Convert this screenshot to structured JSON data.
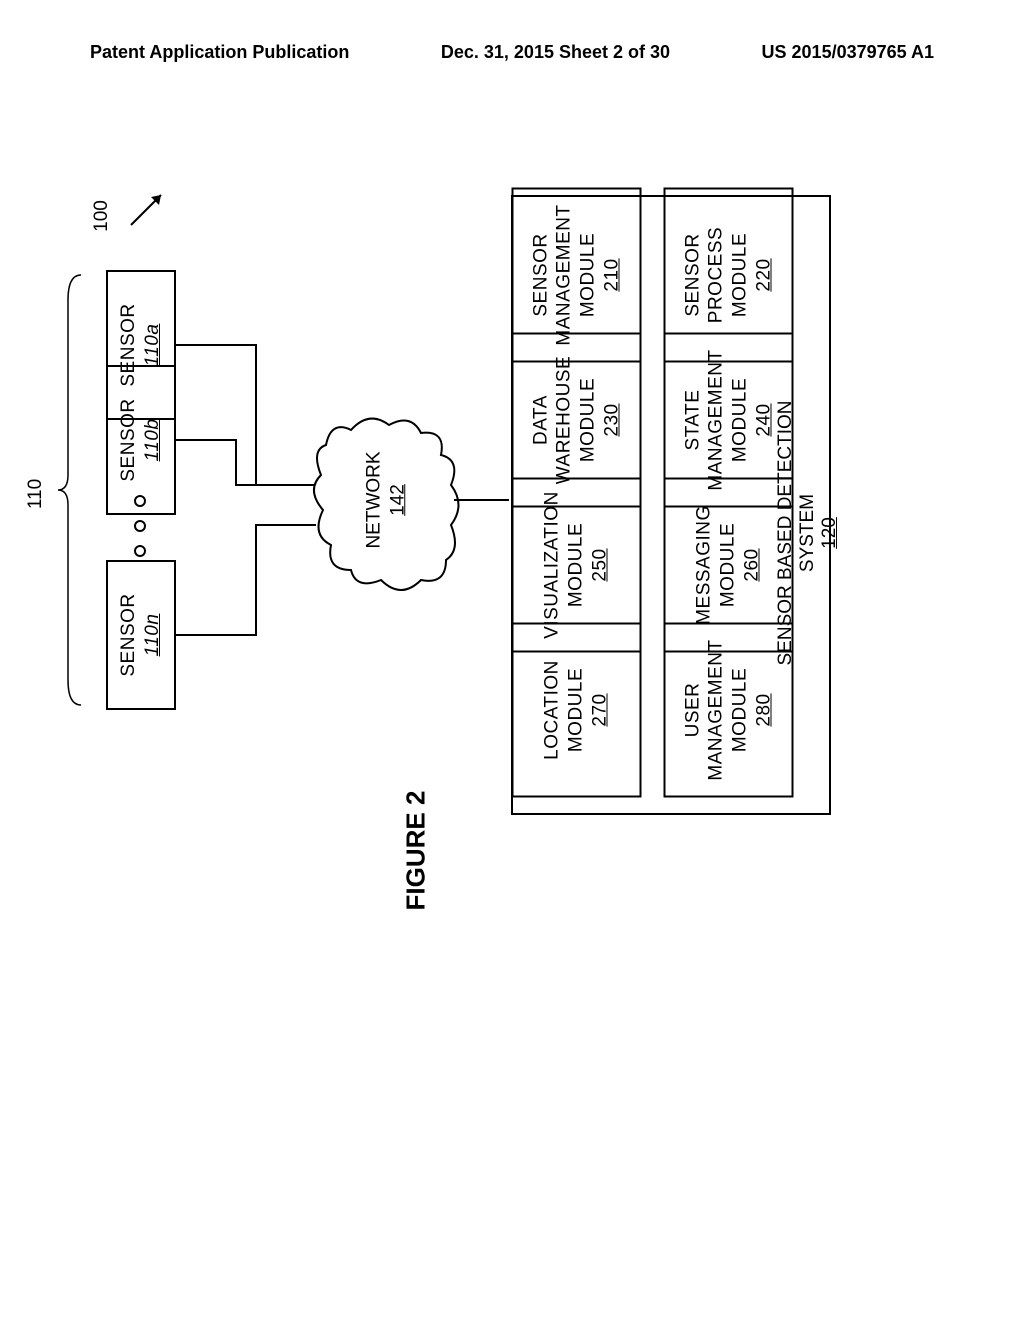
{
  "header": {
    "left": "Patent Application Publication",
    "center": "Dec. 31, 2015  Sheet 2 of 30",
    "right": "US 2015/0379765 A1"
  },
  "ref100": "100",
  "ref110": "110",
  "sensors": {
    "a": {
      "label": "SENSOR",
      "ref": "110a"
    },
    "b": {
      "label": "SENSOR",
      "ref": "110b"
    },
    "n": {
      "label": "SENSOR",
      "ref": "110n"
    }
  },
  "network": {
    "label": "NETWORK",
    "ref": "142"
  },
  "system": {
    "label": "SENSOR BASED DETECTION SYSTEM",
    "ref": "120"
  },
  "modules": {
    "m210": {
      "l1": "SENSOR",
      "l2": "MANAGEMENT",
      "l3": "MODULE",
      "ref": "210"
    },
    "m220": {
      "l1": "SENSOR",
      "l2": "PROCESS",
      "l3": "MODULE",
      "ref": "220"
    },
    "m230": {
      "l1": "DATA",
      "l2": "WAREHOUSE",
      "l3": "MODULE",
      "ref": "230"
    },
    "m240": {
      "l1": "STATE",
      "l2": "MANAGEMENT",
      "l3": "MODULE",
      "ref": "240"
    },
    "m250": {
      "l1": "VISUALIZATION",
      "l2": "MODULE",
      "ref": "250"
    },
    "m260": {
      "l1": "MESSAGING",
      "l2": "MODULE",
      "ref": "260"
    },
    "m270": {
      "l1": "LOCATION",
      "l2": "MODULE",
      "ref": "270"
    },
    "m280": {
      "l1": "USER",
      "l2": "MANAGEMENT",
      "l3": "MODULE",
      "ref": "280"
    }
  },
  "figure_label": "FIGURE 2"
}
